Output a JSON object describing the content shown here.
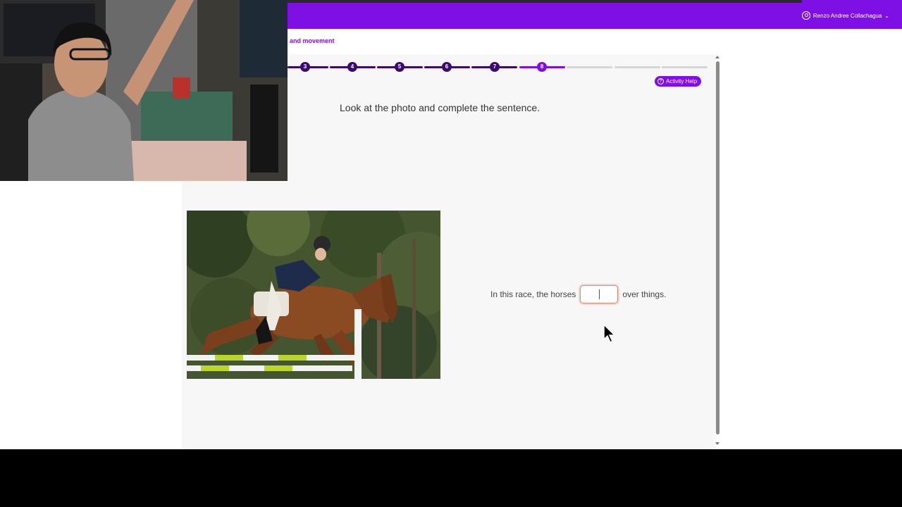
{
  "header": {
    "user_name": "Renzo Andree Collachagua",
    "user_chevron": "⌄"
  },
  "breadcrumb": {
    "text": "and movement"
  },
  "progress": {
    "steps": [
      {
        "label": "3",
        "state": "done"
      },
      {
        "label": "4",
        "state": "done"
      },
      {
        "label": "5",
        "state": "done"
      },
      {
        "label": "6",
        "state": "done"
      },
      {
        "label": "7",
        "state": "done"
      },
      {
        "label": "8",
        "state": "current"
      }
    ],
    "remaining_segments": 3
  },
  "activity_help": {
    "label": "Activity Help",
    "icon": "question-circle-icon"
  },
  "question": {
    "instruction": "Look at the photo and complete the sentence.",
    "sentence_before": "In this race, the horses",
    "answer_value": "",
    "sentence_after": "over things."
  },
  "photo": {
    "icon": "horse-jumping-photo"
  },
  "webcam": {
    "icon": "webcam-overlay"
  },
  "colors": {
    "brand_purple": "#7e10e6",
    "done_step": "#3a0a6e",
    "panel_bg": "#f7f7f7",
    "input_border": "#e08470"
  }
}
